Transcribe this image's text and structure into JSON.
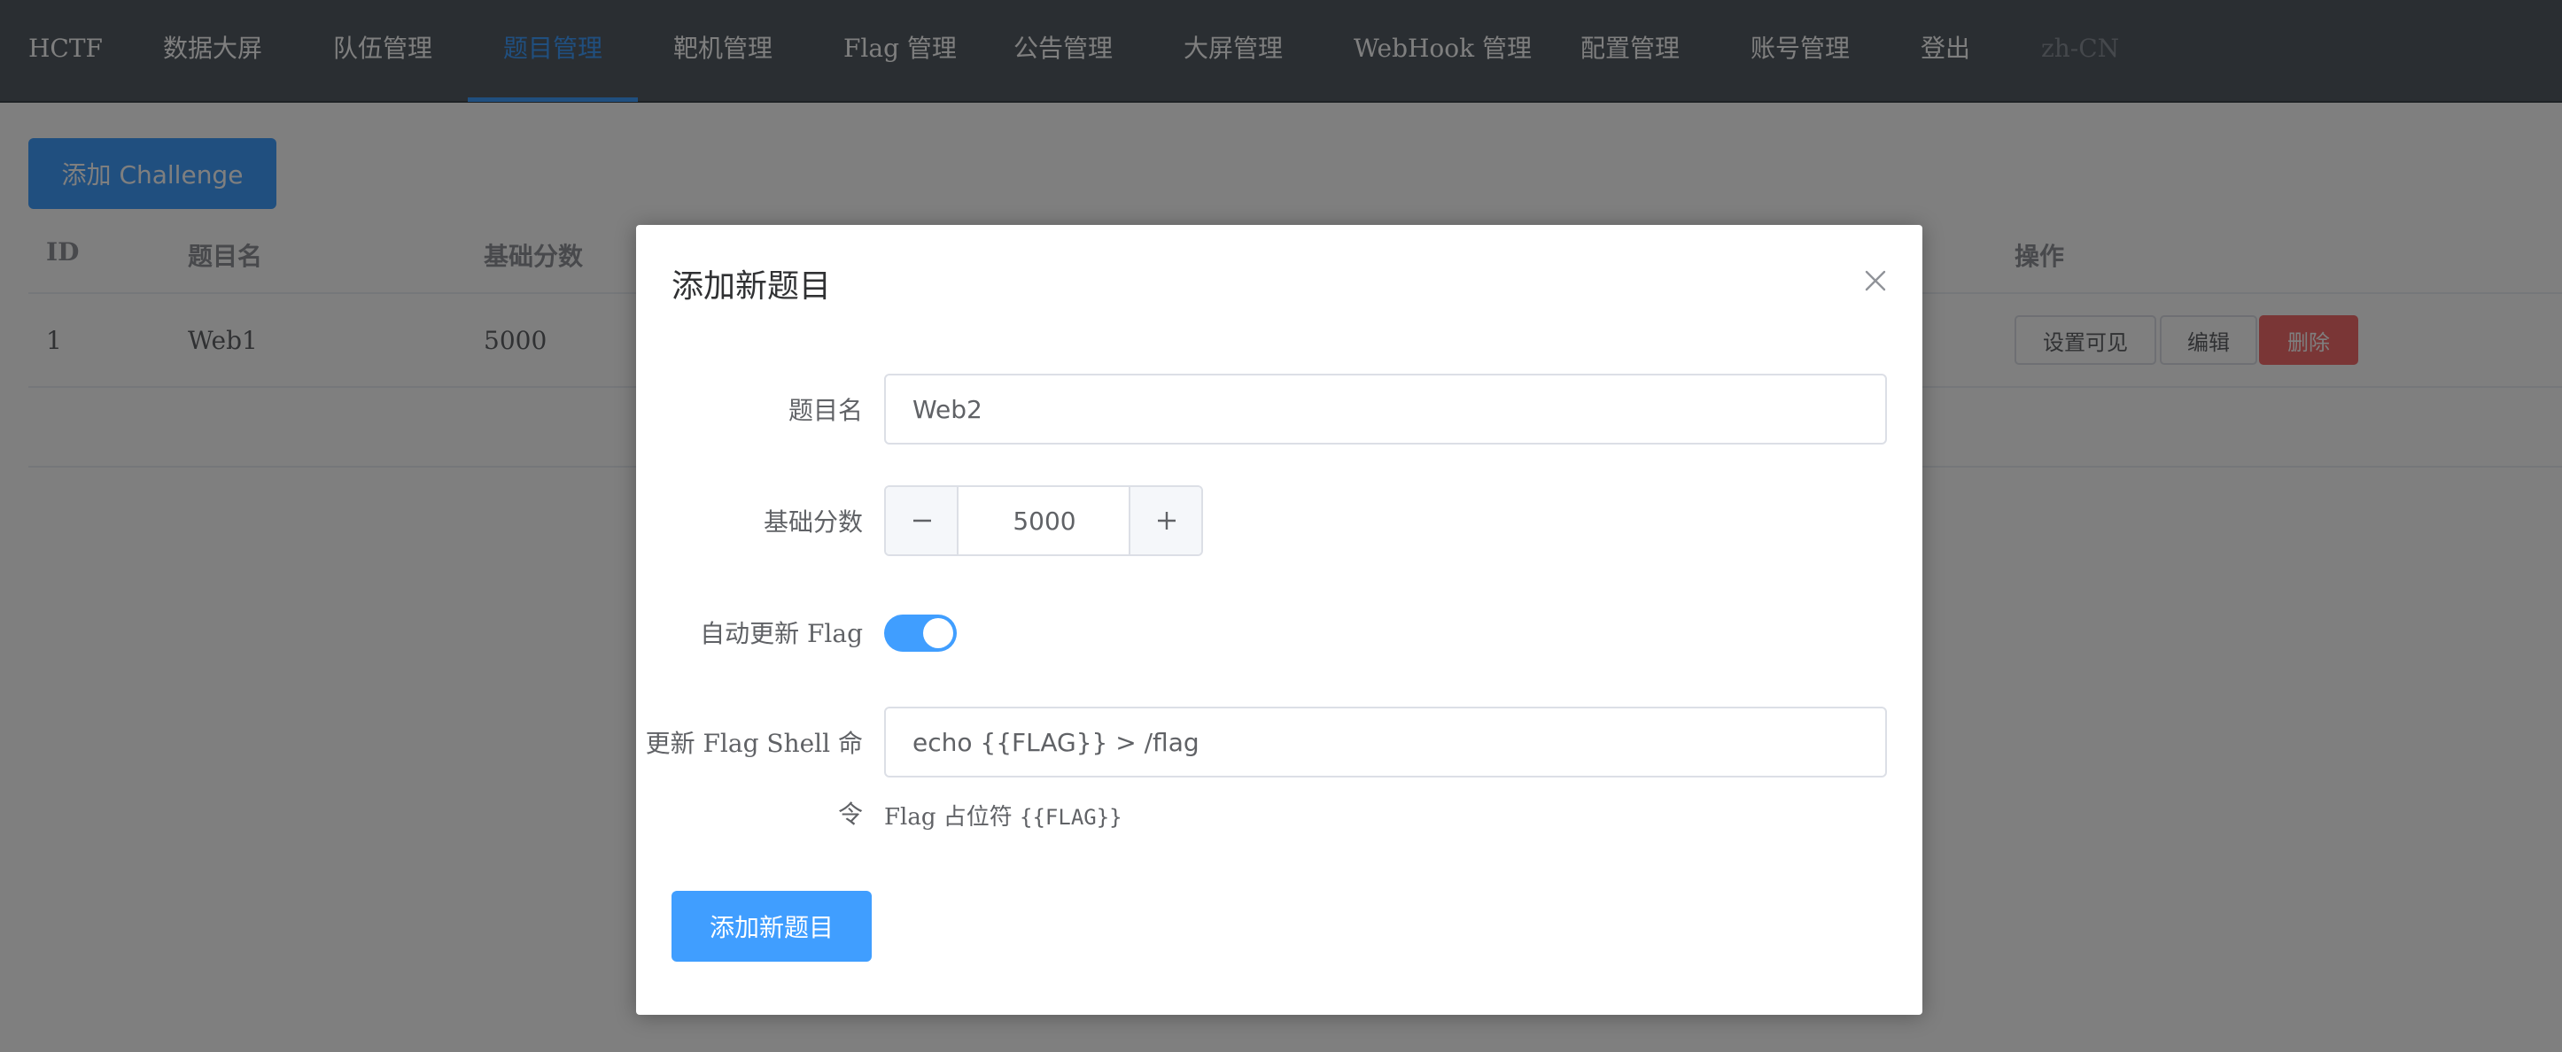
{
  "nav": {
    "brand": "HCTF",
    "items": [
      "数据大屏",
      "队伍管理",
      "题目管理",
      "靶机管理",
      "Flag 管理",
      "公告管理",
      "大屏管理",
      "WebHook 管理",
      "配置管理",
      "账号管理",
      "登出"
    ],
    "active_index": 2,
    "locale": "zh-CN"
  },
  "page": {
    "add_button": "添加 Challenge",
    "table": {
      "headers": {
        "id": "ID",
        "name": "题目名",
        "score": "基础分数",
        "ops": "操作"
      },
      "rows": [
        {
          "id": "1",
          "name": "Web1",
          "score": "5000"
        }
      ],
      "row_actions": {
        "visible": "设置可见",
        "edit": "编辑",
        "delete": "删除"
      }
    }
  },
  "dialog": {
    "title": "添加新题目",
    "fields": {
      "name_label": "题目名",
      "name_value": "Web2",
      "score_label": "基础分数",
      "score_value": "5000",
      "auto_refresh_label": "自动更新 Flag",
      "auto_refresh_on": true,
      "shell_label_line1": "更新 Flag Shell 命",
      "shell_label_line2": "令",
      "shell_value": "echo {{FLAG}} > /flag",
      "shell_help_prefix": "Flag 占位符 ",
      "shell_help_code": "{{FLAG}}"
    },
    "submit_label": "添加新题目"
  },
  "colors": {
    "nav_bg": "#545c64",
    "accent": "#409eff",
    "danger": "#f56c6c",
    "overlay": "rgba(0,0,0,0.5)"
  },
  "icons": {
    "close": "close-icon",
    "minus": "minus-icon",
    "plus": "plus-icon"
  }
}
